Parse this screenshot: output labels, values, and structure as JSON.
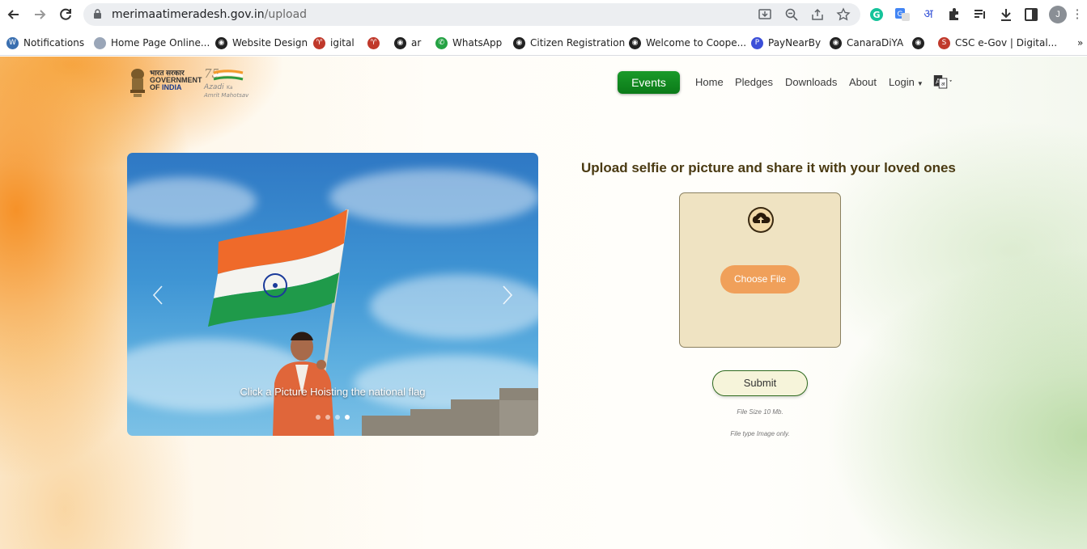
{
  "browser": {
    "url_host": "merimaatimeradesh.gov.in",
    "url_path": "/upload",
    "avatar_initial": "J",
    "bookmarks": [
      {
        "label": "Notifications",
        "icon": "wordpress-icon",
        "color": "#3a6fb0"
      },
      {
        "label": "Home Page Online...",
        "icon": "page-icon",
        "color": "#9aa6b8"
      },
      {
        "label": "Website Design",
        "icon": "globe-icon",
        "color": "#222222"
      },
      {
        "label": "igital",
        "icon": "ribbon-icon",
        "color": "#c0392b"
      },
      {
        "label": "",
        "icon": "ribbon-icon",
        "color": "#c0392b"
      },
      {
        "label": "ar",
        "icon": "globe-icon",
        "color": "#222222"
      },
      {
        "label": "WhatsApp",
        "icon": "whatsapp-icon",
        "color": "#25a244"
      },
      {
        "label": "Citizen Registration",
        "icon": "globe-icon",
        "color": "#222222"
      },
      {
        "label": "Welcome to Coope...",
        "icon": "globe-icon",
        "color": "#222222"
      },
      {
        "label": "PayNearBy",
        "icon": "paynearby-icon",
        "color": "#3b4fd8"
      },
      {
        "label": "CanaraDiYA",
        "icon": "globe-icon",
        "color": "#222222"
      },
      {
        "label": "",
        "icon": "globe-icon",
        "color": "#222222"
      },
      {
        "label": "CSC e-Gov | Digital...",
        "icon": "csc-icon",
        "color": "#c0392b"
      }
    ],
    "more_bookmarks": "»"
  },
  "site": {
    "gov_line1": "भारत सरकार",
    "gov_line2": "GOVERNMENT",
    "gov_line3_of": "OF",
    "gov_line3_india": "INDIA",
    "azadi_line1": "Azadi",
    "azadi_ka": "Ka",
    "azadi_line2": "Amrit Mahotsav",
    "azadi_75": "75"
  },
  "nav": {
    "events": "Events",
    "home": "Home",
    "pledges": "Pledges",
    "downloads": "Downloads",
    "about": "About",
    "login": "Login"
  },
  "carousel": {
    "caption": "Click a Picture Hoisting the national flag",
    "slide_count": 4,
    "active_slide": 4
  },
  "upload": {
    "title": "Upload selfie or picture and share it with your loved ones",
    "choose_file": "Choose File",
    "submit": "Submit",
    "hint_size": "File Size 10 Mb.",
    "hint_type": "File type Image only."
  },
  "colors": {
    "accent_green": "#0b7a18",
    "choose_orange": "#f0a05a",
    "drop_bg": "#efe3c2",
    "title_brown": "#4a3a12"
  }
}
